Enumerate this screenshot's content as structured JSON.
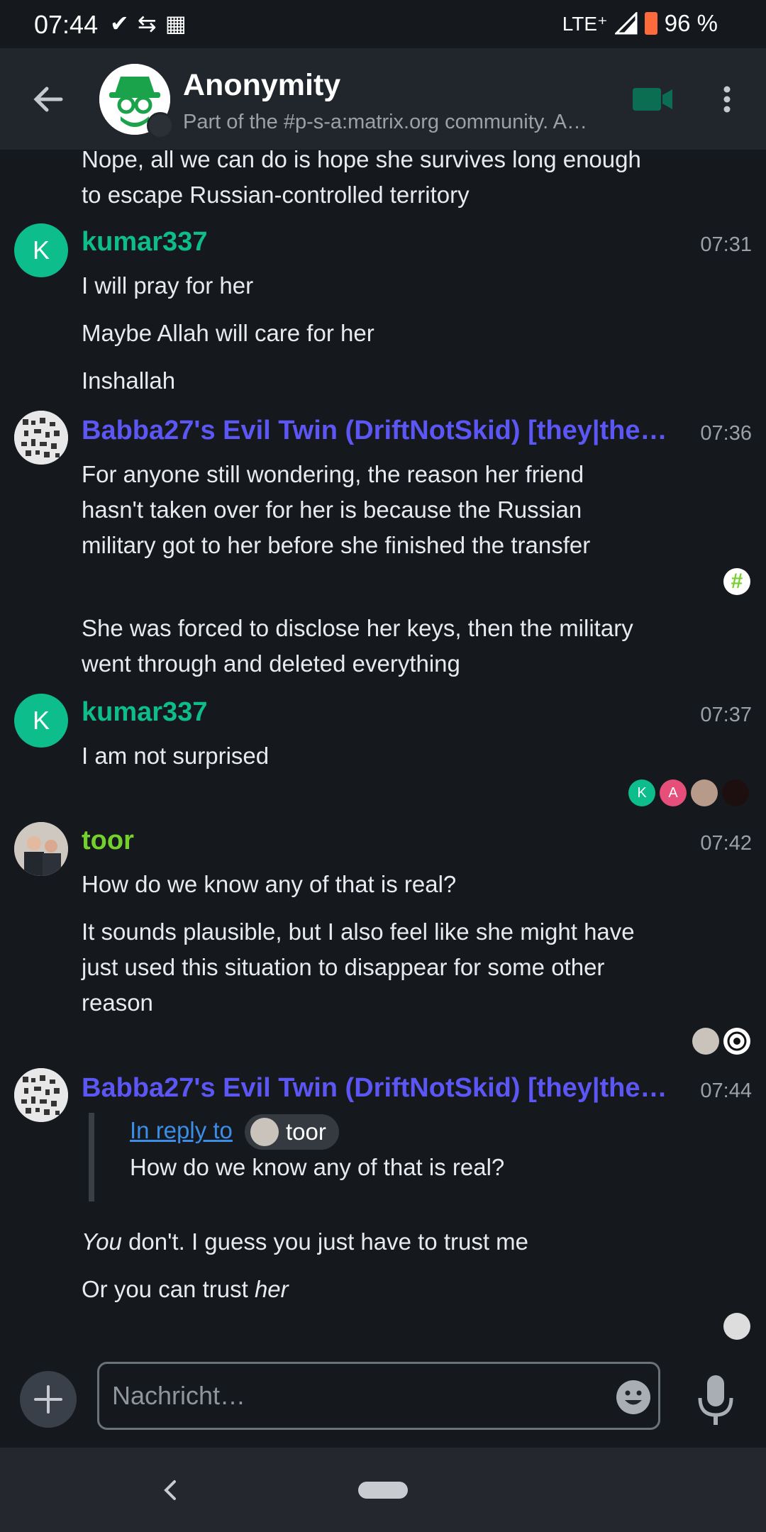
{
  "status_bar": {
    "time": "07:44",
    "network": "LTE⁺",
    "battery": "96 %",
    "icons": [
      "check-icon",
      "data-saver-icon",
      "grid-icon",
      "signal-icon",
      "battery-icon"
    ]
  },
  "room": {
    "name": "Anonymity",
    "topic": "Part of the #p-s-a:matrix.org community. A…",
    "accent": "#0dbd8b"
  },
  "messages": {
    "m0": {
      "lines": [
        "Nope, all we can do is hope she survives long enough",
        "to escape Russian-controlled territory"
      ]
    },
    "m1": {
      "sender": "kumar337",
      "initial": "K",
      "time": "07:31",
      "texts": [
        "I will pray for her",
        "Maybe Allah will care for her",
        "Inshallah"
      ]
    },
    "m2": {
      "sender": "Babba27's Evil Twin (DriftNotSkid) [they|the…",
      "time": "07:36",
      "para1": [
        "For anyone still wondering, the reason her friend",
        "hasn't taken over for her is because the Russian",
        "military got to her before she finished the transfer"
      ],
      "para2": [
        "She was forced to disclose her keys, then the military",
        "went through and deleted everything"
      ]
    },
    "m3": {
      "sender": "kumar337",
      "initial": "K",
      "time": "07:37",
      "text": "I am not surprised",
      "receipts": [
        {
          "initial": "K"
        },
        {
          "initial": "A"
        }
      ]
    },
    "m4": {
      "sender": "toor",
      "time": "07:42",
      "text1": "How do we know any of that is real?",
      "text2": [
        "It sounds plausible, but I also feel like she might have",
        "just used this situation to disappear for some other",
        "reason"
      ]
    },
    "m5": {
      "sender": "Babba27's Evil Twin (DriftNotSkid) [they|the…",
      "time": "07:44",
      "reply_link": "In reply to",
      "reply_user": "toor",
      "reply_quote": "How do we know any of that is real?",
      "line1_em": "You",
      "line1_rest": " don't. I guess you just have to trust me",
      "line2_pre": "Or you can trust ",
      "line2_em": "her"
    }
  },
  "colors": {
    "kumar": "#0dbd8b",
    "babba": "#5c56f5",
    "toor": "#74d12c",
    "receipt_a": "#e64f7a"
  },
  "composer": {
    "placeholder": "Nachricht…"
  }
}
